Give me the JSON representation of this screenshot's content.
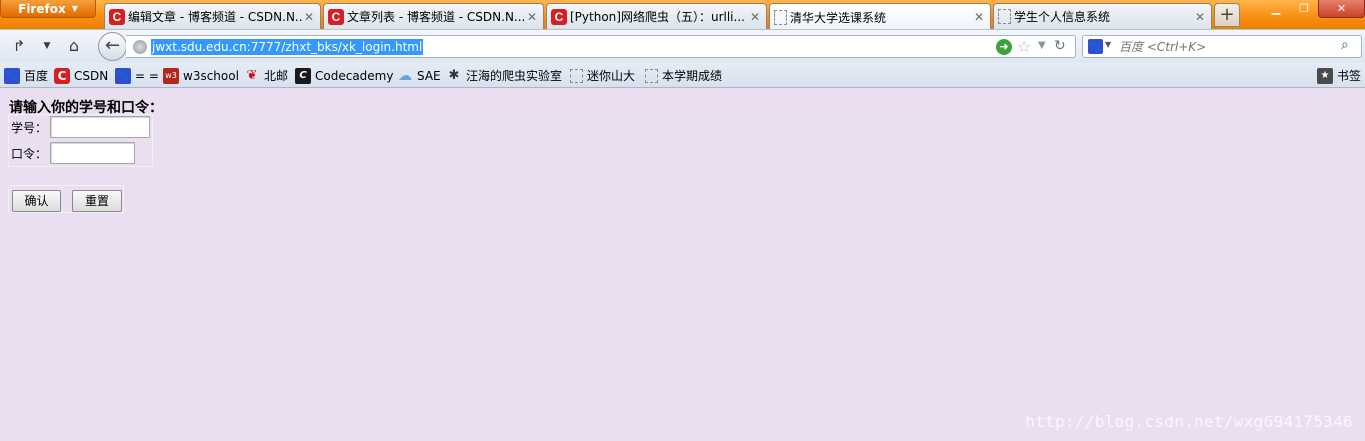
{
  "browser": {
    "app_menu_label": "Firefox",
    "tabs": [
      {
        "label": "编辑文章 - 博客频道 - CSDN.N...",
        "favicon": "csdn-icon",
        "selected": false
      },
      {
        "label": "文章列表 - 博客频道 - CSDN.N...",
        "favicon": "csdn-icon",
        "selected": false
      },
      {
        "label": "[Python]网络爬虫（五）：urlli...",
        "favicon": "csdn-icon",
        "selected": false
      },
      {
        "label": "清华大学选课系统",
        "favicon": "blank-page-icon",
        "selected": true
      },
      {
        "label": "学生个人信息系统",
        "favicon": "blank-page-icon",
        "selected": false
      }
    ],
    "new_tab_label": "+",
    "address": {
      "url": "jwxt.sdu.edu.cn:7777/zhxt_bks/xk_login.html"
    },
    "search": {
      "placeholder": "百度 <Ctrl+K>"
    },
    "bookmarks": [
      {
        "label": "百度",
        "icon": "baidu-paw-icon"
      },
      {
        "label": "CSDN",
        "icon": "csdn-icon"
      },
      {
        "label": "= =",
        "icon": "baidu-paw-icon"
      },
      {
        "label": "w3school",
        "icon": "w3school-icon"
      },
      {
        "label": "北邮",
        "icon": "bupt-icon"
      },
      {
        "label": "Codecademy",
        "icon": "codecademy-icon"
      },
      {
        "label": "SAE",
        "icon": "sae-cloud-icon"
      },
      {
        "label": "汪海的爬虫实验室",
        "icon": "spider-icon"
      },
      {
        "label": "迷你山大",
        "icon": "blank-page-icon"
      },
      {
        "label": "本学期成绩",
        "icon": "blank-page-icon"
      }
    ],
    "bookmarks_menu_label": "书签"
  },
  "login_form": {
    "heading": "请输入你的学号和口令：",
    "student_id_label": "学号：",
    "student_id_value": "",
    "password_label": "口令：",
    "password_value": "",
    "confirm_label": "确认",
    "reset_label": "重置"
  },
  "watermark": "http://blog.csdn.net/wxg694175346",
  "colors": {
    "titlebar": "#f78c10",
    "page_background": "#e9dff0",
    "url_selection": "#3399ff"
  }
}
